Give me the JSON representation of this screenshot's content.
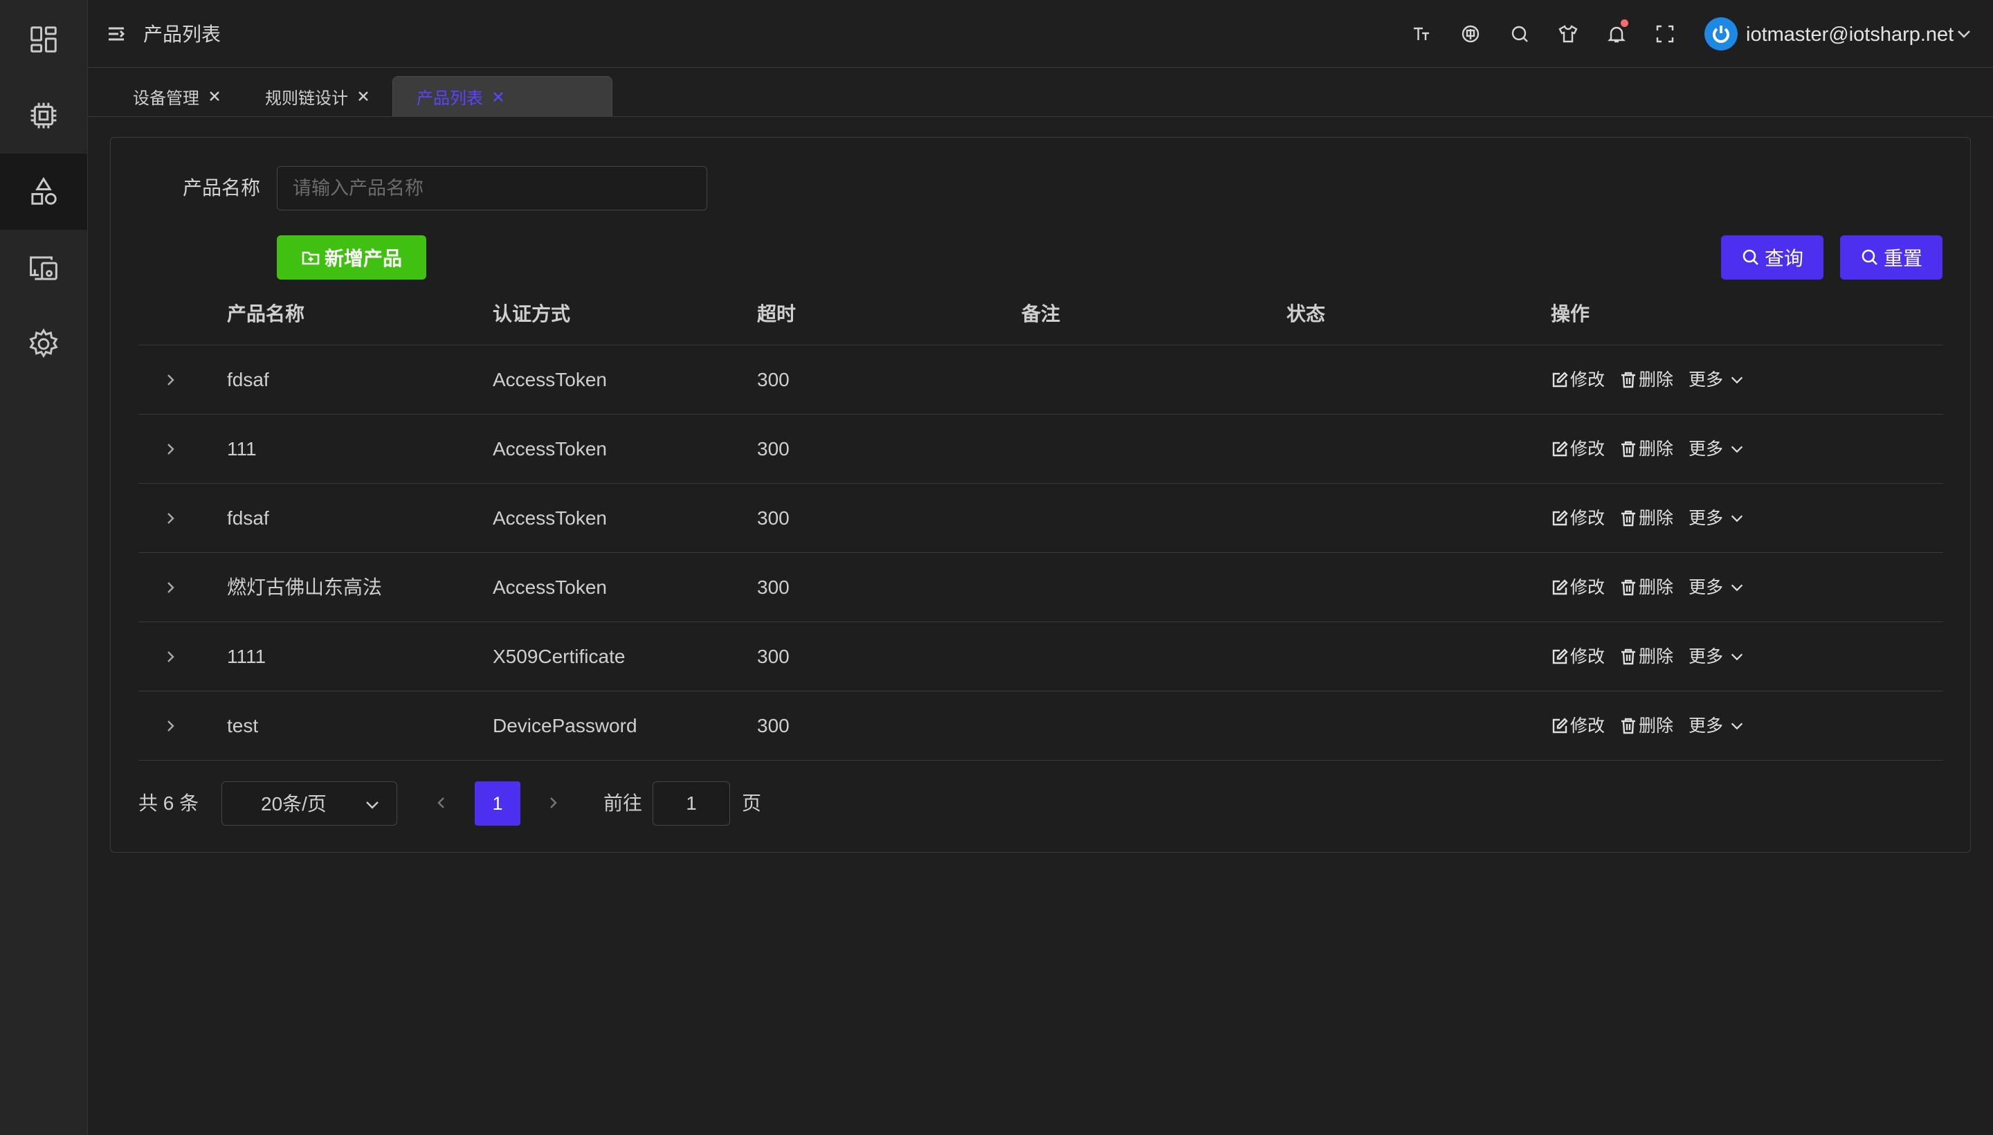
{
  "sidebar": {
    "items": [
      {
        "icon": "dashboard-icon"
      },
      {
        "icon": "chip-icon"
      },
      {
        "icon": "shapes-icon",
        "active": true
      },
      {
        "icon": "devices-icon"
      },
      {
        "icon": "gear-icon"
      }
    ]
  },
  "header": {
    "title": "产品列表",
    "icons": [
      "font-size-icon",
      "language-icon",
      "search-icon",
      "theme-shirt-icon",
      "bell-icon",
      "fullscreen-icon"
    ],
    "user": "iotmaster@iotsharp.net"
  },
  "tabs": [
    {
      "label": "设备管理",
      "active": false
    },
    {
      "label": "规则链设计",
      "active": false
    },
    {
      "label": "产品列表",
      "active": true
    }
  ],
  "search": {
    "label": "产品名称",
    "placeholder": "请输入产品名称",
    "value": ""
  },
  "buttons": {
    "add": "新增产品",
    "query": "查询",
    "reset": "重置"
  },
  "table": {
    "columns": [
      "产品名称",
      "认证方式",
      "超时",
      "备注",
      "状态",
      "操作"
    ],
    "rows": [
      {
        "name": "fdsaf",
        "auth": "AccessToken",
        "timeout": "300",
        "remark": "",
        "status": ""
      },
      {
        "name": "111",
        "auth": "AccessToken",
        "timeout": "300",
        "remark": "",
        "status": ""
      },
      {
        "name": "fdsaf",
        "auth": "AccessToken",
        "timeout": "300",
        "remark": "",
        "status": ""
      },
      {
        "name": "燃灯古佛山东高法",
        "auth": "AccessToken",
        "timeout": "300",
        "remark": "",
        "status": ""
      },
      {
        "name": "1111",
        "auth": "X509Certificate",
        "timeout": "300",
        "remark": "",
        "status": ""
      },
      {
        "name": "test",
        "auth": "DevicePassword",
        "timeout": "300",
        "remark": "",
        "status": ""
      }
    ],
    "actions": {
      "edit": "修改",
      "delete": "删除",
      "more": "更多"
    }
  },
  "pagination": {
    "total": "共 6 条",
    "page_size": "20条/页",
    "current_page": "1",
    "goto_label": "前往",
    "goto_value": "1",
    "page_suffix": "页"
  },
  "colors": {
    "accent": "#4d2ff0",
    "add_button": "#40c010",
    "background": "#1f1f1f",
    "sidebar": "#262626",
    "notification_dot": "#f56c6c",
    "avatar": "#1e88e5"
  }
}
